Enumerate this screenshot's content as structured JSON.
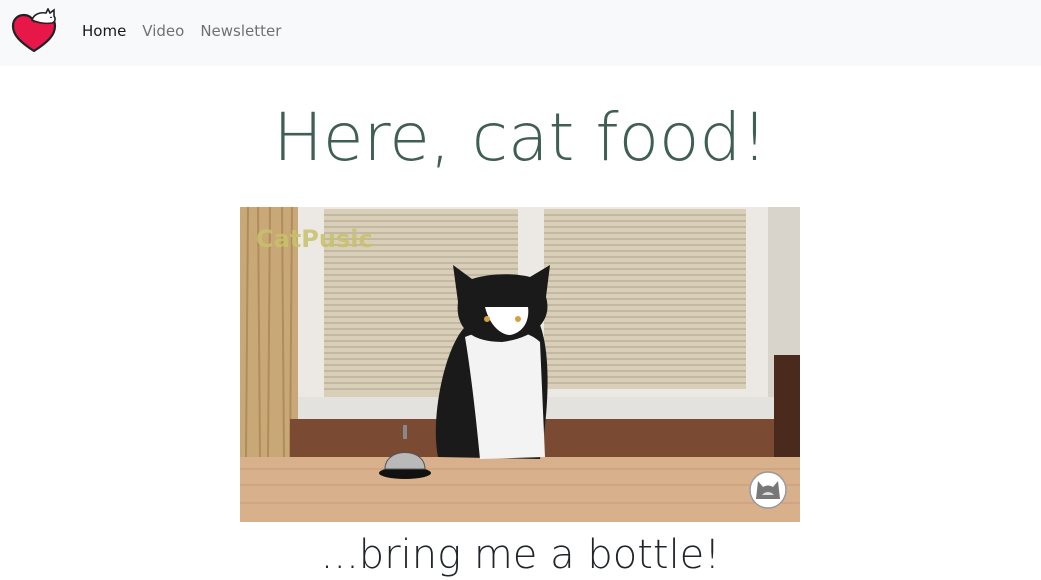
{
  "nav": {
    "brand_icon": "heart-cat-logo-icon",
    "links": [
      {
        "label": "Home",
        "active": true
      },
      {
        "label": "Video",
        "active": false
      },
      {
        "label": "Newsletter",
        "active": false
      }
    ]
  },
  "main": {
    "title": "Here, cat food!",
    "video": {
      "watermark": "CatPusic",
      "channel_icon": "channel-cat-avatar-icon"
    },
    "subtitle": "...bring me a bottle!"
  },
  "colors": {
    "title": "#3f5e55",
    "navbar_bg": "#f8f9fa",
    "logo_heart": "#e8174a"
  }
}
